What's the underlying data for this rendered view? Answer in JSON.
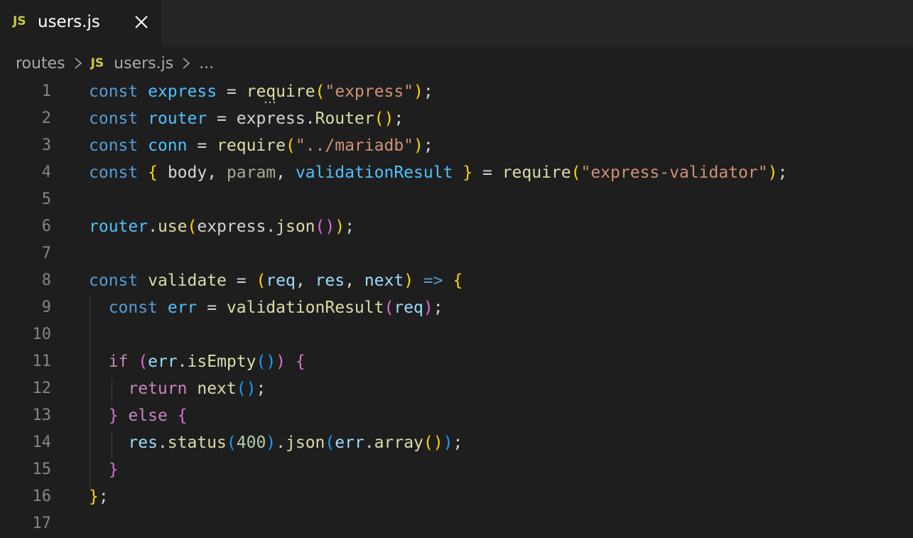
{
  "tab": {
    "icon_text": "JS",
    "label": "users.js",
    "close_icon": "close-icon"
  },
  "breadcrumb": {
    "folder": "routes",
    "file_icon_text": "JS",
    "file": "users.js",
    "more": "..."
  },
  "colors": {
    "background": "#1e1e1e",
    "tabbar": "#252526",
    "keyword": "#569cd6",
    "control": "#c586c0",
    "constant": "#4fc1ff",
    "variable": "#9cdcfe",
    "function": "#dcdcaa",
    "string": "#ce9178",
    "number": "#b5cea8",
    "bracket1": "#ffd700",
    "bracket2": "#da70d6",
    "bracket3": "#179fff",
    "js_icon": "#cbcb41"
  },
  "editor": {
    "lines": [
      {
        "n": "1",
        "tokens": [
          [
            "kw",
            "const"
          ],
          [
            "op",
            " "
          ],
          [
            "cn",
            "express"
          ],
          [
            "op",
            " = "
          ],
          [
            "fn",
            "require"
          ],
          [
            "b1",
            "("
          ],
          [
            "str",
            "\"express\""
          ],
          [
            "b1",
            ")"
          ],
          [
            "op",
            ";"
          ]
        ]
      },
      {
        "n": "2",
        "tokens": [
          [
            "kw",
            "const"
          ],
          [
            "op",
            " "
          ],
          [
            "cn",
            "router"
          ],
          [
            "op",
            " = "
          ],
          [
            "op",
            "express."
          ],
          [
            "fn",
            "Router"
          ],
          [
            "b1",
            "()"
          ],
          [
            "op",
            ";"
          ]
        ]
      },
      {
        "n": "3",
        "tokens": [
          [
            "kw",
            "const"
          ],
          [
            "op",
            " "
          ],
          [
            "cn",
            "conn"
          ],
          [
            "op",
            " = "
          ],
          [
            "fn",
            "require"
          ],
          [
            "b1",
            "("
          ],
          [
            "str",
            "\"../mariadb\""
          ],
          [
            "b1",
            ")"
          ],
          [
            "op",
            ";"
          ]
        ]
      },
      {
        "n": "4",
        "tokens": [
          [
            "kw",
            "const"
          ],
          [
            "op",
            " "
          ],
          [
            "b1",
            "{"
          ],
          [
            "op",
            " body, "
          ],
          [
            "unused",
            "param"
          ],
          [
            "op",
            ", "
          ],
          [
            "cn",
            "validationResult"
          ],
          [
            "op",
            " "
          ],
          [
            "b1",
            "}"
          ],
          [
            "op",
            " = "
          ],
          [
            "fn",
            "require"
          ],
          [
            "b1",
            "("
          ],
          [
            "str",
            "\"express-validator\""
          ],
          [
            "b1",
            ")"
          ],
          [
            "op",
            ";"
          ]
        ]
      },
      {
        "n": "5",
        "tokens": []
      },
      {
        "n": "6",
        "tokens": [
          [
            "cn",
            "router"
          ],
          [
            "op",
            "."
          ],
          [
            "fn",
            "use"
          ],
          [
            "b1",
            "("
          ],
          [
            "op",
            "express."
          ],
          [
            "fn",
            "json"
          ],
          [
            "b2",
            "()"
          ],
          [
            "b1",
            ")"
          ],
          [
            "op",
            ";"
          ]
        ]
      },
      {
        "n": "7",
        "tokens": []
      },
      {
        "n": "8",
        "tokens": [
          [
            "kw",
            "const"
          ],
          [
            "op",
            " "
          ],
          [
            "fn",
            "validate"
          ],
          [
            "op",
            " = "
          ],
          [
            "b1",
            "("
          ],
          [
            "vr",
            "req"
          ],
          [
            "op",
            ", "
          ],
          [
            "vr",
            "res"
          ],
          [
            "op",
            ", "
          ],
          [
            "vr",
            "next"
          ],
          [
            "b1",
            ")"
          ],
          [
            "op",
            " "
          ],
          [
            "kw",
            "=>"
          ],
          [
            "op",
            " "
          ],
          [
            "b1",
            "{"
          ]
        ]
      },
      {
        "n": "9",
        "tokens": [
          [
            "op",
            "  "
          ],
          [
            "kw",
            "const"
          ],
          [
            "op",
            " "
          ],
          [
            "cn",
            "err"
          ],
          [
            "op",
            " = "
          ],
          [
            "fn",
            "validationResult"
          ],
          [
            "b2",
            "("
          ],
          [
            "vr",
            "req"
          ],
          [
            "b2",
            ")"
          ],
          [
            "op",
            ";"
          ]
        ]
      },
      {
        "n": "10",
        "tokens": []
      },
      {
        "n": "11",
        "tokens": [
          [
            "op",
            "  "
          ],
          [
            "ctl",
            "if"
          ],
          [
            "op",
            " "
          ],
          [
            "b2",
            "("
          ],
          [
            "vr",
            "err"
          ],
          [
            "op",
            "."
          ],
          [
            "fn",
            "isEmpty"
          ],
          [
            "b3",
            "()"
          ],
          [
            "b2",
            ")"
          ],
          [
            "op",
            " "
          ],
          [
            "b2",
            "{"
          ]
        ]
      },
      {
        "n": "12",
        "tokens": [
          [
            "op",
            "    "
          ],
          [
            "ctl",
            "return"
          ],
          [
            "op",
            " "
          ],
          [
            "fn",
            "next"
          ],
          [
            "b3",
            "()"
          ],
          [
            "op",
            ";"
          ]
        ]
      },
      {
        "n": "13",
        "tokens": [
          [
            "op",
            "  "
          ],
          [
            "b2",
            "}"
          ],
          [
            "op",
            " "
          ],
          [
            "ctl",
            "else"
          ],
          [
            "op",
            " "
          ],
          [
            "b2",
            "{"
          ]
        ]
      },
      {
        "n": "14",
        "tokens": [
          [
            "op",
            "    "
          ],
          [
            "vr",
            "res"
          ],
          [
            "op",
            "."
          ],
          [
            "fn",
            "status"
          ],
          [
            "b3",
            "("
          ],
          [
            "num",
            "400"
          ],
          [
            "b3",
            ")"
          ],
          [
            "op",
            "."
          ],
          [
            "fn",
            "json"
          ],
          [
            "b3",
            "("
          ],
          [
            "vr",
            "err"
          ],
          [
            "op",
            "."
          ],
          [
            "fn",
            "array"
          ],
          [
            "b1",
            "()"
          ],
          [
            "b3",
            ")"
          ],
          [
            "op",
            ";"
          ]
        ]
      },
      {
        "n": "15",
        "tokens": [
          [
            "op",
            "  "
          ],
          [
            "b2",
            "}"
          ]
        ]
      },
      {
        "n": "16",
        "tokens": [
          [
            "b1",
            "}"
          ],
          [
            "op",
            ";"
          ]
        ]
      },
      {
        "n": "17",
        "tokens": []
      }
    ]
  }
}
